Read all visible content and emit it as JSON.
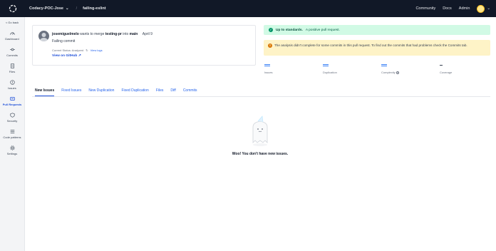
{
  "topbar": {
    "org": "Codacy-POC-Jose",
    "repo": "failing-eslint",
    "links": [
      "Community",
      "Docs",
      "Admin"
    ]
  },
  "sidebar": {
    "back": "< Go back",
    "items": [
      {
        "label": "Dashboard",
        "icon": "dashboard-icon"
      },
      {
        "label": "Commits",
        "icon": "commit-icon"
      },
      {
        "label": "Files",
        "icon": "file-icon"
      },
      {
        "label": "Issues",
        "icon": "issues-icon"
      },
      {
        "label": "Pull Requests",
        "icon": "pull-request-icon",
        "active": true
      },
      {
        "label": "Security",
        "icon": "shield-icon"
      },
      {
        "label": "Code patterns",
        "icon": "list-icon"
      },
      {
        "label": "Settings",
        "icon": "gear-icon"
      }
    ]
  },
  "pr": {
    "author": "josemiguelmelo",
    "wants": "wants to merge",
    "source": "testing-pr",
    "into": "into",
    "target": "main",
    "date": "April 9",
    "title": "Failing commit",
    "status_label": "Current Status: Analyzed",
    "logs": "View logs",
    "github": "View on GitHub"
  },
  "banners": {
    "ok_strong": "Up to standards.",
    "ok_text": "A positive pull request.",
    "warn": "The analysis didn't complete for some commits in this pull request. To find out the commits that had problems check the Commits tab."
  },
  "metrics": [
    {
      "label": "Issues",
      "icon": "equals-icon"
    },
    {
      "label": "Duplication",
      "icon": "equals-icon"
    },
    {
      "label": "Complexity",
      "icon": "equals-icon",
      "help": "?"
    },
    {
      "label": "Coverage",
      "icon": "dash-icon"
    }
  ],
  "tabs": [
    "New Issues",
    "Fixed Issues",
    "New Duplication",
    "Fixed Duplication",
    "Files",
    "Diff",
    "Commits"
  ],
  "empty_message": "Woo! You don't have new issues."
}
